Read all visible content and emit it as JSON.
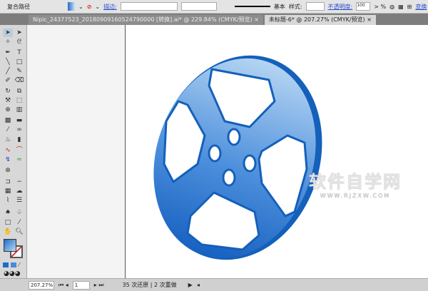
{
  "control_bar": {
    "object_type": "复合路径",
    "stroke_label": "描边:",
    "stroke_style": "基本",
    "style_label": "样式:",
    "opacity_label": "不透明度:",
    "opacity_value": "100",
    "opacity_unit": "> %",
    "transform_label": "变换"
  },
  "tabs": [
    {
      "label": "Nipic_24377523_20180909160524790000 [转换].ai* @ 229.84% (CMYK/预览)",
      "active": false
    },
    {
      "label": "未标题-6* @ 207.27% (CMYK/预览)",
      "active": true
    }
  ],
  "status": {
    "zoom": "207.27%",
    "page": "1",
    "undo_info": "35 次还原 | 2 次重做"
  },
  "watermark": {
    "title": "软件自学网",
    "url": "WWW.RJZXW.COM"
  },
  "colors": {
    "accent": "#1f6cc8",
    "rim": "#1460bb",
    "light": "#a9cdf0"
  }
}
